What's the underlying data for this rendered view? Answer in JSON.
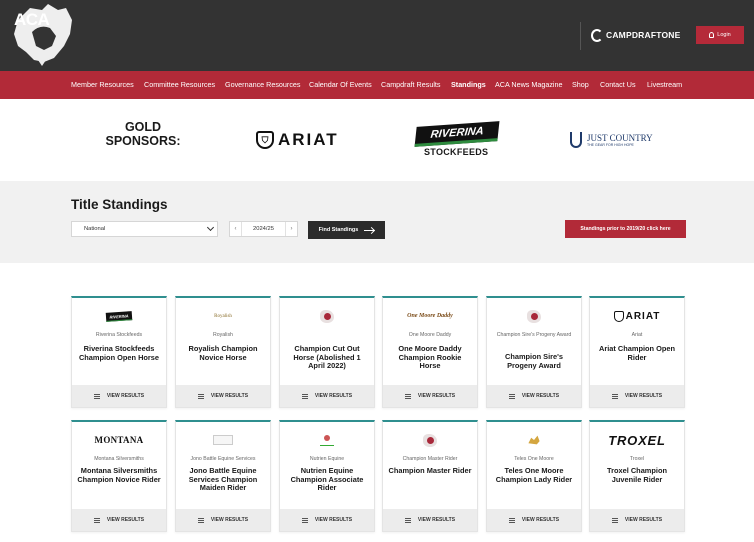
{
  "header": {
    "logo_text": "ACA",
    "partner_logo": "CAMPDRAFTONE",
    "login_label": "Login"
  },
  "nav": {
    "items": [
      {
        "label": "Member Resources",
        "active": false
      },
      {
        "label": "Committee Resources",
        "active": false
      },
      {
        "label": "Governance Resources",
        "active": false
      },
      {
        "label": "Calendar Of Events",
        "active": false
      },
      {
        "label": "Campdraft Results",
        "active": false
      },
      {
        "label": "Standings",
        "active": true
      },
      {
        "label": "ACA News Magazine",
        "active": false
      },
      {
        "label": "Shop",
        "active": false
      },
      {
        "label": "Contact Us",
        "active": false
      },
      {
        "label": "Livestream",
        "active": false
      }
    ]
  },
  "sponsors": {
    "heading": "GOLD SPONSORS:",
    "ariat": "ARIAT",
    "riverina_flag": "RIVERINA",
    "riverina_sub": "STOCKFEEDS",
    "justcountry": "JUST COUNTRY",
    "justcountry_tag": "THE GEAR FOR HIGH HOPE"
  },
  "filters": {
    "title": "Title Standings",
    "competition_selected": "National",
    "season_value": "2024/25",
    "prev_glyph": "‹",
    "next_glyph": "›",
    "find_label": "Find Standings",
    "prior_label": "Standings prior to 2019/20 click here"
  },
  "cards": [
    {
      "sponsor": "Riverina Stockfeeds",
      "name": "Riverina Stockfeeds Champion Open Horse",
      "logo_text": "RIVERINA",
      "logo_icon": "riverina-logo",
      "action": "VIEW RESULTS"
    },
    {
      "sponsor": "Royalish",
      "name": "Royalish Champion Novice Horse",
      "logo_text": "Royalish",
      "logo_icon": "royalish-logo",
      "action": "VIEW RESULTS"
    },
    {
      "sponsor": "",
      "name": "Champion Cut Out Horse (Abolished 1 April 2022)",
      "logo_text": "",
      "logo_icon": "aca-logo",
      "action": "VIEW RESULTS"
    },
    {
      "sponsor": "One Moore Daddy",
      "name": "One Moore Daddy Champion Rookie Horse",
      "logo_text": "One Moore Daddy",
      "logo_icon": "one-moore-daddy-logo",
      "action": "VIEW RESULTS"
    },
    {
      "sponsor": "Champion Sire's Progeny Award",
      "name": "Champion Sire's Progeny Award",
      "logo_text": "",
      "logo_icon": "aca-logo",
      "action": "VIEW RESULTS"
    },
    {
      "sponsor": "Ariat",
      "name": "Ariat Champion Open Rider",
      "logo_text": "ARIAT",
      "logo_icon": "ariat-logo",
      "action": "VIEW RESULTS"
    },
    {
      "sponsor": "Montana Silversmiths",
      "name": "Montana Silversmiths Champion Novice Rider",
      "logo_text": "MONTANA",
      "logo_icon": "montana-logo",
      "action": "VIEW RESULTS"
    },
    {
      "sponsor": "Jono Battle Equine Services",
      "name": "Jono Battle Equine Services Champion Maiden Rider",
      "logo_text": "",
      "logo_icon": "jono-battle-logo",
      "action": "VIEW RESULTS"
    },
    {
      "sponsor": "Nutrien Equine",
      "name": "Nutrien Equine Champion Associate Rider",
      "logo_text": "",
      "logo_icon": "nutrien-logo",
      "action": "VIEW RESULTS"
    },
    {
      "sponsor": "Champion Master Rider",
      "name": "Champion Master Rider",
      "logo_text": "",
      "logo_icon": "aca-logo",
      "action": "VIEW RESULTS"
    },
    {
      "sponsor": "Teles One Moore",
      "name": "Teles One Moore Champion Lady Rider",
      "logo_text": "",
      "logo_icon": "teles-logo",
      "action": "VIEW RESULTS"
    },
    {
      "sponsor": "Troxel",
      "name": "Troxel Champion Juvenile Rider",
      "logo_text": "TROXEL",
      "logo_icon": "troxel-logo",
      "action": "VIEW RESULTS"
    }
  ],
  "colors": {
    "topbar": "#333333",
    "brand_red": "#b22a38",
    "filter_bg": "#f1f1f1",
    "card_accent": "#2f8f8f"
  }
}
